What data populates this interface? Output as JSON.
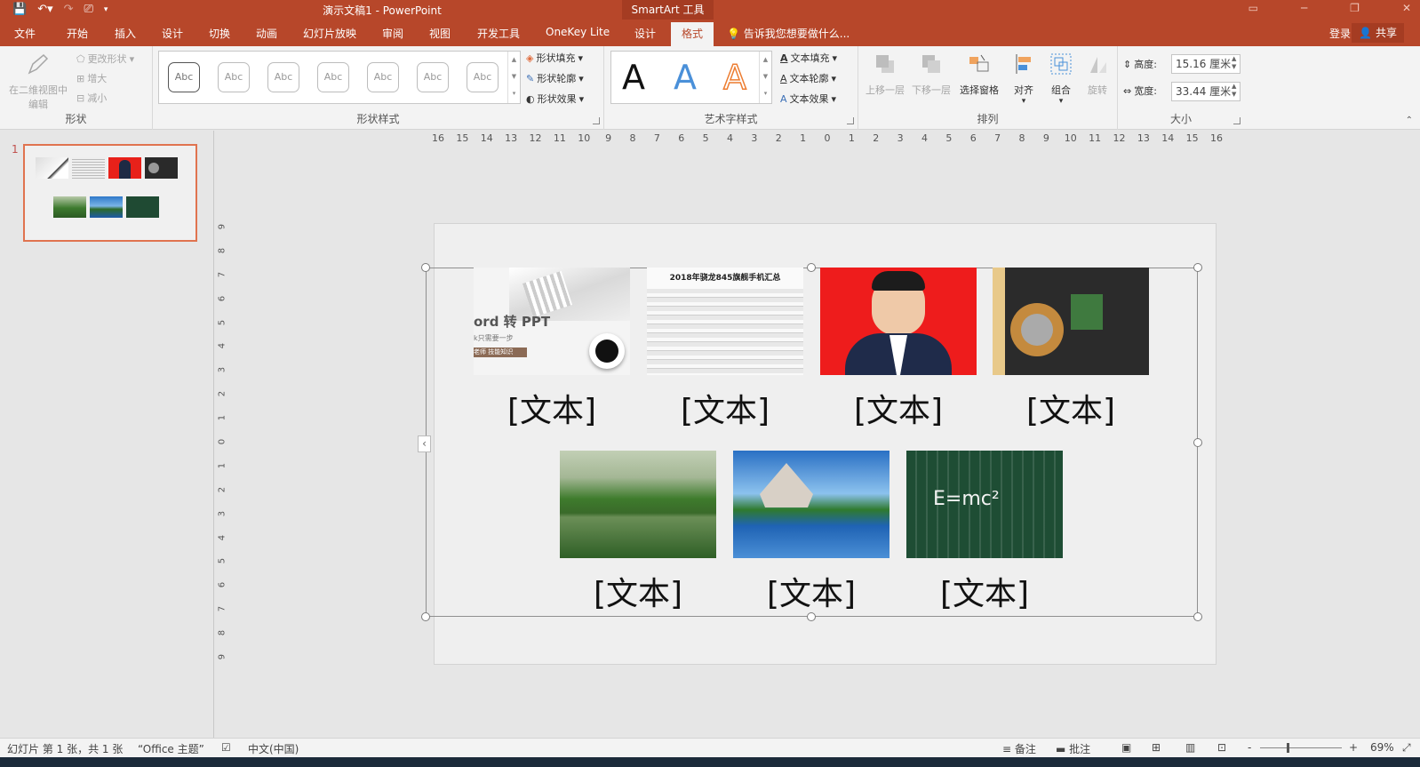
{
  "titlebar": {
    "title": "演示文稿1 - PowerPoint",
    "contextual_header": "SmartArt 工具"
  },
  "tabs": {
    "file": "文件",
    "home": "开始",
    "insert": "插入",
    "design": "设计",
    "transitions": "切换",
    "animations": "动画",
    "slideshow": "幻灯片放映",
    "review": "审阅",
    "view": "视图",
    "developer": "开发工具",
    "onekey": "OneKey Lite",
    "sa_design": "设计",
    "sa_format": "格式",
    "tell_me": "告诉我您想要做什么...",
    "login": "登录",
    "share": "共享"
  },
  "ribbon": {
    "shapes": {
      "edit_in_2d_line1": "在二维视图中",
      "edit_in_2d_line2": "编辑",
      "change_shape": "更改形状",
      "larger": "增大",
      "smaller": "减小",
      "label": "形状"
    },
    "shape_styles": {
      "thumb_text": "Abc",
      "fill": "形状填充",
      "outline": "形状轮廓",
      "effects": "形状效果",
      "label": "形状样式"
    },
    "wordart": {
      "glyph": "A",
      "text_fill": "文本填充",
      "text_outline": "文本轮廓",
      "text_effects": "文本效果",
      "label": "艺术字样式"
    },
    "arrange": {
      "bring_forward": "上移一层",
      "send_backward": "下移一层",
      "selection_pane": "选择窗格",
      "align": "对齐",
      "group": "组合",
      "rotate": "旋转",
      "label": "排列"
    },
    "size": {
      "height_label": "高度:",
      "height_value": "15.16 厘米",
      "width_label": "宽度:",
      "width_value": "33.44 厘米",
      "label": "大小"
    }
  },
  "thumbnail": {
    "slide_number": "1"
  },
  "ruler": {
    "horizontal": [
      "16",
      "15",
      "14",
      "13",
      "12",
      "11",
      "10",
      "9",
      "8",
      "7",
      "6",
      "5",
      "4",
      "3",
      "2",
      "1",
      "0",
      "1",
      "2",
      "3",
      "4",
      "5",
      "6",
      "7",
      "8",
      "9",
      "10",
      "11",
      "12",
      "13",
      "14",
      "15",
      "16"
    ],
    "vertical": [
      "9",
      "8",
      "7",
      "6",
      "5",
      "4",
      "3",
      "2",
      "1",
      "0",
      "1",
      "2",
      "3",
      "4",
      "5",
      "6",
      "7",
      "8",
      "9"
    ]
  },
  "smartart": {
    "placeholder": "[文本]",
    "images": [
      {
        "id": "word-ppt",
        "caption_text": "ord 转 PPT",
        "sub1": "k只需要一步",
        "sub2": "老师 技能知识"
      },
      {
        "id": "phone-table",
        "heading": "2018年骁龙845旗舰手机汇总"
      },
      {
        "id": "portrait"
      },
      {
        "id": "laptop-internals"
      },
      {
        "id": "lake-forest"
      },
      {
        "id": "temple-lake"
      },
      {
        "id": "chalkboard",
        "formula": "E=mc²"
      }
    ]
  },
  "status": {
    "slide_info": "幻灯片 第 1 张，共 1 张",
    "theme": "“Office 主题”",
    "language": "中文(中国)",
    "notes": "备注",
    "comments": "批注",
    "zoom_minus": "-",
    "zoom_plus": "+",
    "zoom": "69%"
  },
  "colors": {
    "accent": "#b7472a",
    "accent_dark": "#a53c22",
    "wordart_blue": "#4a90d9",
    "wordart_orange": "#ed7d31"
  }
}
